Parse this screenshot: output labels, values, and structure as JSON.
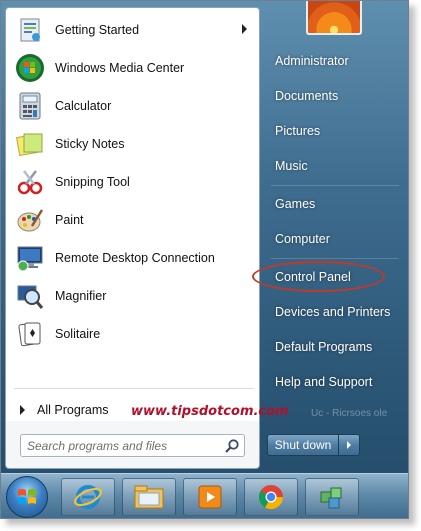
{
  "programs": [
    {
      "label": "Getting Started",
      "icon": "getting-started-icon",
      "has_submenu": true
    },
    {
      "label": "Windows Media Center",
      "icon": "windows-media-center-icon"
    },
    {
      "label": "Calculator",
      "icon": "calculator-icon"
    },
    {
      "label": "Sticky Notes",
      "icon": "sticky-notes-icon"
    },
    {
      "label": "Snipping Tool",
      "icon": "snipping-tool-icon"
    },
    {
      "label": "Paint",
      "icon": "paint-icon"
    },
    {
      "label": "Remote Desktop Connection",
      "icon": "remote-desktop-icon"
    },
    {
      "label": "Magnifier",
      "icon": "magnifier-icon"
    },
    {
      "label": "Solitaire",
      "icon": "solitaire-icon"
    }
  ],
  "all_programs_label": "All Programs",
  "watermark": "www.tipsdotcom.com",
  "search": {
    "placeholder": "Search programs and files"
  },
  "right_items": [
    {
      "label": "Administrator"
    },
    {
      "label": "Documents"
    },
    {
      "label": "Pictures"
    },
    {
      "label": "Music"
    },
    {
      "label": "Games"
    },
    {
      "label": "Computer"
    },
    {
      "label": "Control Panel"
    },
    {
      "label": "Devices and Printers"
    },
    {
      "label": "Default Programs"
    },
    {
      "label": "Help and Support"
    }
  ],
  "shutdown_label": "Shut down",
  "ghost_text": "Uc - Ricrsoes ole",
  "taskbar": [
    "start-orb",
    "internet-explorer-icon",
    "file-explorer-icon",
    "media-player-icon",
    "chrome-icon",
    "app-icon"
  ],
  "colors": {
    "highlight_ring": "#c0392b",
    "watermark": "#b0102a",
    "panel_blue": "#3f6d90"
  }
}
